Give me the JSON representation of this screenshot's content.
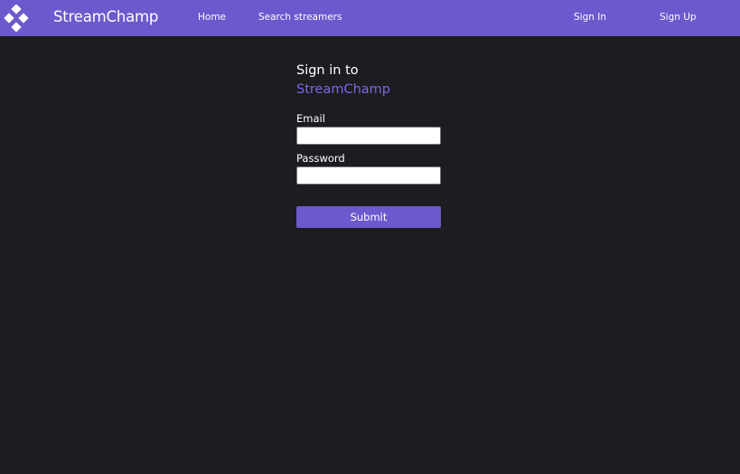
{
  "navbar": {
    "logo_icon": "diamond-grid-logo-icon",
    "brand": "StreamChamp",
    "links": {
      "home": "Home",
      "search": "Search streamers",
      "sign_in": "Sign In",
      "sign_up": "Sign Up"
    }
  },
  "form": {
    "title_line1": "Sign in to",
    "title_brand": "StreamChamp",
    "email_label": "Email",
    "email_value": "",
    "password_label": "Password",
    "password_value": "",
    "submit_label": "Submit"
  },
  "colors": {
    "accent": "#6a5acd",
    "brand_text": "#7b68e8",
    "background": "#1c1d20"
  }
}
